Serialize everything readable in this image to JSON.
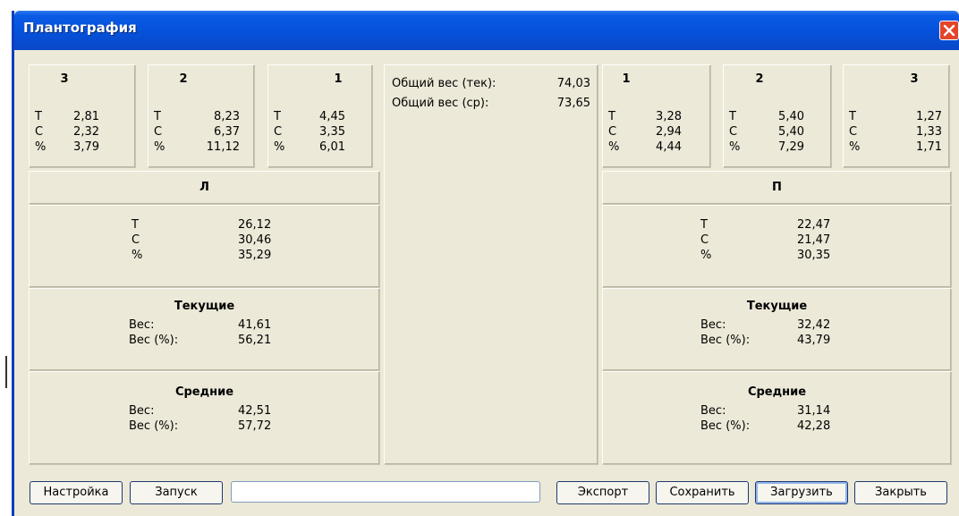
{
  "window": {
    "title": "Плантография"
  },
  "left_sensors": [
    {
      "label": "3",
      "T": "2,81",
      "C": "2,32",
      "P": "3,79"
    },
    {
      "label": "2",
      "T": "8,23",
      "C": "6,37",
      "P": "11,12"
    },
    {
      "label": "1",
      "T": "4,45",
      "C": "3,35",
      "P": "6,01"
    }
  ],
  "right_sensors": [
    {
      "label": "1",
      "T": "3,28",
      "C": "2,94",
      "P": "4,44"
    },
    {
      "label": "2",
      "T": "5,40",
      "C": "5,40",
      "P": "7,29"
    },
    {
      "label": "3",
      "T": "1,27",
      "C": "1,33",
      "P": "1,71"
    }
  ],
  "row_labels": {
    "T": "T",
    "C": "C",
    "P": "%"
  },
  "left": {
    "title": "Л",
    "totals": {
      "T": "26,12",
      "C": "30,46",
      "P": "35,29"
    },
    "current": {
      "title": "Текущие",
      "weight_label": "Вес:",
      "weight": "41,61",
      "pct_label": "Вес (%):",
      "pct": "56,21"
    },
    "average": {
      "title": "Средние",
      "weight_label": "Вес:",
      "weight": "42,51",
      "pct_label": "Вес (%):",
      "pct": "57,72"
    }
  },
  "right": {
    "title": "П",
    "totals": {
      "T": "22,47",
      "C": "21,47",
      "P": "30,35"
    },
    "current": {
      "title": "Текущие",
      "weight_label": "Вес:",
      "weight": "32,42",
      "pct_label": "Вес (%):",
      "pct": "43,79"
    },
    "average": {
      "title": "Средние",
      "weight_label": "Вес:",
      "weight": "31,14",
      "pct_label": "Вес (%):",
      "pct": "42,28"
    }
  },
  "center": {
    "total_cur_label": "Общий вес (тек):",
    "total_cur": "74,03",
    "total_avg_label": "Общий вес (ср):",
    "total_avg": "73,65"
  },
  "buttons": {
    "settings": "Настройка",
    "start": "Запуск",
    "export": "Экспорт",
    "save": "Сохранить",
    "load": "Загрузить",
    "close": "Закрыть"
  },
  "colors": {
    "titlebar": "#0551da",
    "window_bg": "#ece9d8",
    "close": "#e2452a"
  }
}
